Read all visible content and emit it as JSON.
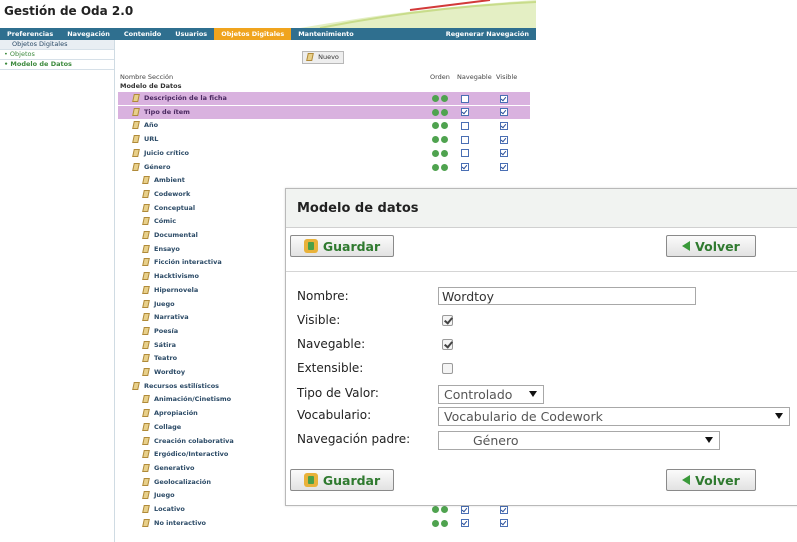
{
  "app": {
    "title": "Gestión de Oda 2.0"
  },
  "menu": {
    "items": [
      "Preferencias",
      "Navegación",
      "Contenido",
      "Usuarios",
      "Objetos Digitales",
      "Mantenimiento"
    ],
    "active": "Objetos Digitales",
    "right": "Regenerar Navegación"
  },
  "sidebar": {
    "items": [
      "Objetos Digitales",
      "Objetos",
      "Modelo de Datos"
    ]
  },
  "main": {
    "nuevo_label": "Nuevo",
    "columns": {
      "name": "Nombre Sección",
      "order": "Orden",
      "navigable": "Navegable",
      "visible": "Visible"
    },
    "root_label": "Modelo de Datos",
    "rows": [
      {
        "label": "Descripción de la ficha",
        "level": 1,
        "highlight": true,
        "navegable": false,
        "visible": true
      },
      {
        "label": "Tipo de ítem",
        "level": 1,
        "highlight": true,
        "navegable": true,
        "visible": true
      },
      {
        "label": "Año",
        "level": 1,
        "navegable": false,
        "visible": true
      },
      {
        "label": "URL",
        "level": 1,
        "navegable": false,
        "visible": true
      },
      {
        "label": "Juicio crítico",
        "level": 1,
        "navegable": false,
        "visible": true
      },
      {
        "label": "Género",
        "level": 1,
        "navegable": true,
        "visible": true
      },
      {
        "label": "Ambient",
        "level": 2
      },
      {
        "label": "Codework",
        "level": 2
      },
      {
        "label": "Conceptual",
        "level": 2
      },
      {
        "label": "Cómic",
        "level": 2
      },
      {
        "label": "Documental",
        "level": 2
      },
      {
        "label": "Ensayo",
        "level": 2
      },
      {
        "label": "Ficción interactiva",
        "level": 2
      },
      {
        "label": "Hacktivismo",
        "level": 2
      },
      {
        "label": "Hipernovela",
        "level": 2
      },
      {
        "label": "Juego",
        "level": 2
      },
      {
        "label": "Narrativa",
        "level": 2
      },
      {
        "label": "Poesía",
        "level": 2
      },
      {
        "label": "Sátira",
        "level": 2
      },
      {
        "label": "Teatro",
        "level": 2
      },
      {
        "label": "Wordtoy",
        "level": 2
      },
      {
        "label": "Recursos estilísticos",
        "level": 1
      },
      {
        "label": "Animación/Cinetismo",
        "level": 2
      },
      {
        "label": "Apropiación",
        "level": 2
      },
      {
        "label": "Collage",
        "level": 2
      },
      {
        "label": "Creación colaborativa",
        "level": 2
      },
      {
        "label": "Ergódico/Interactivo",
        "level": 2
      },
      {
        "label": "Generativo",
        "level": 2
      },
      {
        "label": "Geolocalización",
        "level": 2
      },
      {
        "label": "Juego",
        "level": 2
      },
      {
        "label": "Locativo",
        "level": 2,
        "navegable": true,
        "visible": true
      },
      {
        "label": "No interactivo",
        "level": 2,
        "navegable": true,
        "visible": true
      }
    ]
  },
  "modal": {
    "title": "Modelo de datos",
    "save_label": "Guardar",
    "back_label": "Volver",
    "labels": {
      "nombre": "Nombre:",
      "visible": "Visible:",
      "navegable": "Navegable:",
      "extensible": "Extensible:",
      "tipo_valor": "Tipo de Valor:",
      "vocabulario": "Vocabulario:",
      "navegacion_padre": "Navegación padre:"
    },
    "values": {
      "nombre": "Wordtoy",
      "visible": true,
      "navegable": true,
      "extensible": false,
      "tipo_valor": "Controlado",
      "vocabulario": "Vocabulario de Codework",
      "navegacion_padre": "Género"
    }
  },
  "colors": {
    "menu_bg": "#2f6f8f",
    "menu_active": "#f0a41e",
    "row_highlight": "#d9b2df",
    "button_text": "#2f7a2f"
  }
}
